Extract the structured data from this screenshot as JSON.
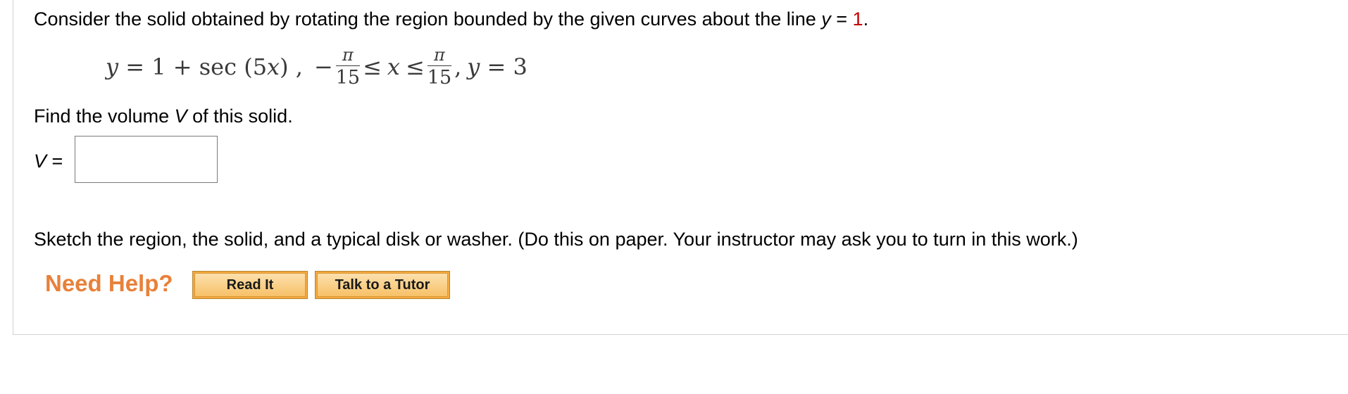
{
  "question": {
    "intro": "Consider the solid obtained by rotating the region bounded by the given curves about the line ",
    "axis_var": "y",
    "axis_eq": " = ",
    "axis_value": "1",
    "axis_end": ".",
    "colors": {
      "axis_value": "#c00000"
    }
  },
  "equation": {
    "y_var": "y",
    "eq1": " = 1 + sec (5",
    "x_var": "x",
    "eq1_close": ") ,",
    "neg": "−",
    "lower_num": "π",
    "lower_den": "15",
    "leq1": "≤",
    "x_mid": "x",
    "leq2": "≤",
    "upper_num": "π",
    "upper_den": "15",
    "comma": ",",
    "y_var2": "y",
    "eq2": " = 3"
  },
  "find": {
    "prefix": "Find the volume ",
    "var": "V",
    "suffix": " of this solid."
  },
  "answer": {
    "label_var": "V",
    "label_eq": " =",
    "value": "",
    "placeholder": ""
  },
  "sketch": {
    "text": "Sketch the region, the solid, and a typical disk or washer. (Do this on paper. Your instructor may ask you to turn in this work.)"
  },
  "help": {
    "label": "Need Help?",
    "read_it": "Read It",
    "talk_to_tutor": "Talk to a Tutor",
    "colors": {
      "label": "#e8813a",
      "button": "#f5a83d"
    }
  }
}
